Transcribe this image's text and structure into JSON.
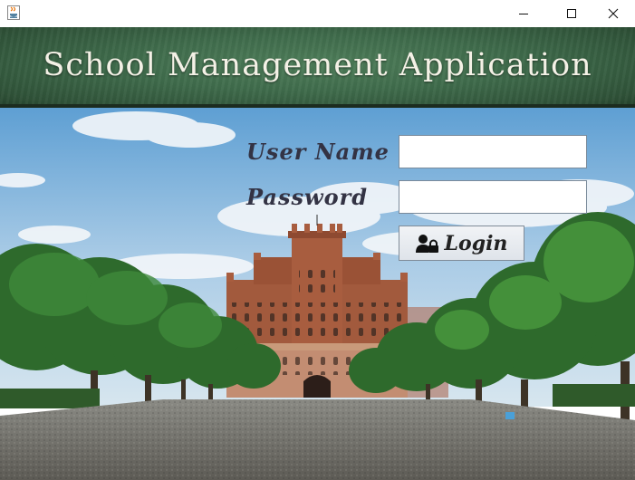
{
  "window": {
    "controls": [
      "minimize-icon",
      "maximize-icon",
      "close-icon"
    ]
  },
  "header": {
    "title": "School Management Application"
  },
  "form": {
    "username_label": "User Name",
    "username_value": "",
    "password_label": "Password",
    "password_value": "",
    "login_button_label": "Login",
    "login_icon": "user-lock-icon"
  },
  "colors": {
    "banner": "#3f6b4b",
    "title_text": "#f4f1e6",
    "label_text": "#333344"
  }
}
